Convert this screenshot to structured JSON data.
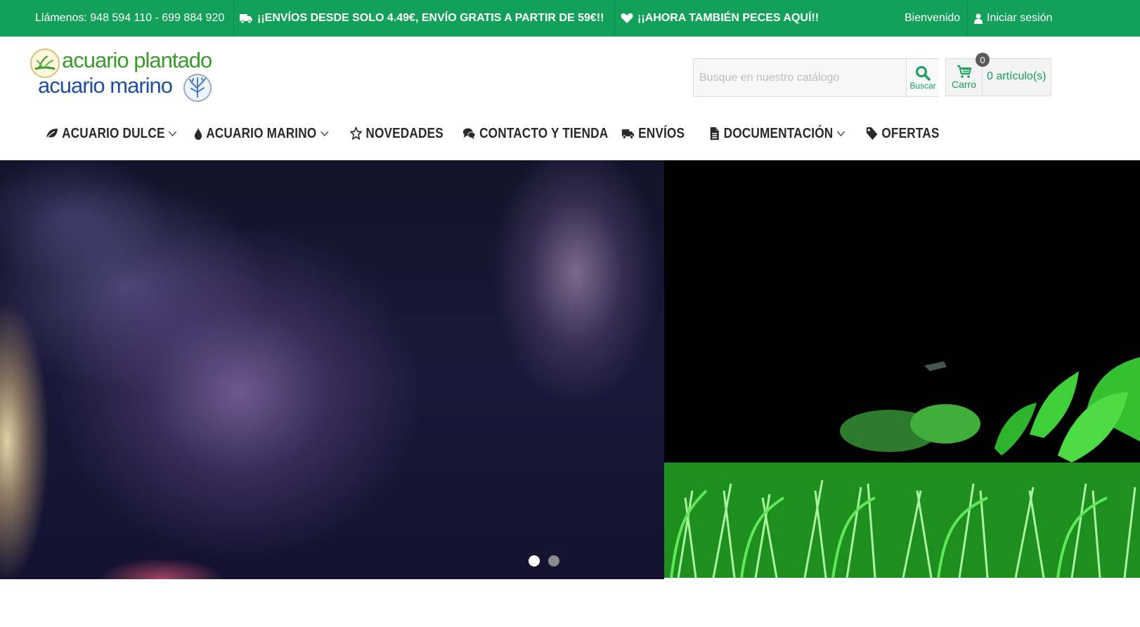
{
  "topbar": {
    "phone": "Llámenos: 948 594 110 - 699 884 920",
    "shipping_promo": "¡¡ENVÍOS DESDE SOLO 4.49€, ENVÍO GRATIS A PARTIR DE 59€!!",
    "fish_promo": "¡¡AHORA TAMBIÉN PECES AQUÍ!!",
    "welcome": "Bienvenido",
    "login": "Iniciar sesión"
  },
  "logo": {
    "line1": "acuario plantado",
    "line2": "acuario marino"
  },
  "search": {
    "placeholder": "Busque en nuestro catálogo",
    "button_label": "Buscar"
  },
  "cart": {
    "label": "Carro",
    "count": "0",
    "items_text": "0 artículo(s)"
  },
  "nav": [
    {
      "label": "ACUARIO DULCE",
      "icon": "leaf-icon",
      "dropdown": true
    },
    {
      "label": "ACUARIO MARINO",
      "icon": "drop-icon",
      "dropdown": true
    },
    {
      "label": "NOVEDADES",
      "icon": "star-icon",
      "dropdown": false
    },
    {
      "label": "CONTACTO Y TIENDA",
      "icon": "comments-icon",
      "dropdown": false
    },
    {
      "label": "ENVÍOS",
      "icon": "truck-icon",
      "dropdown": false
    },
    {
      "label": "DOCUMENTACIÓN",
      "icon": "document-icon",
      "dropdown": true
    },
    {
      "label": "OFERTAS",
      "icon": "tag-icon",
      "dropdown": false
    }
  ],
  "carousel": {
    "slides": 2,
    "active": 1
  },
  "colors": {
    "brand_green": "#13a05a",
    "logo_green": "#3a9a2b",
    "logo_blue": "#1f4fa0"
  }
}
